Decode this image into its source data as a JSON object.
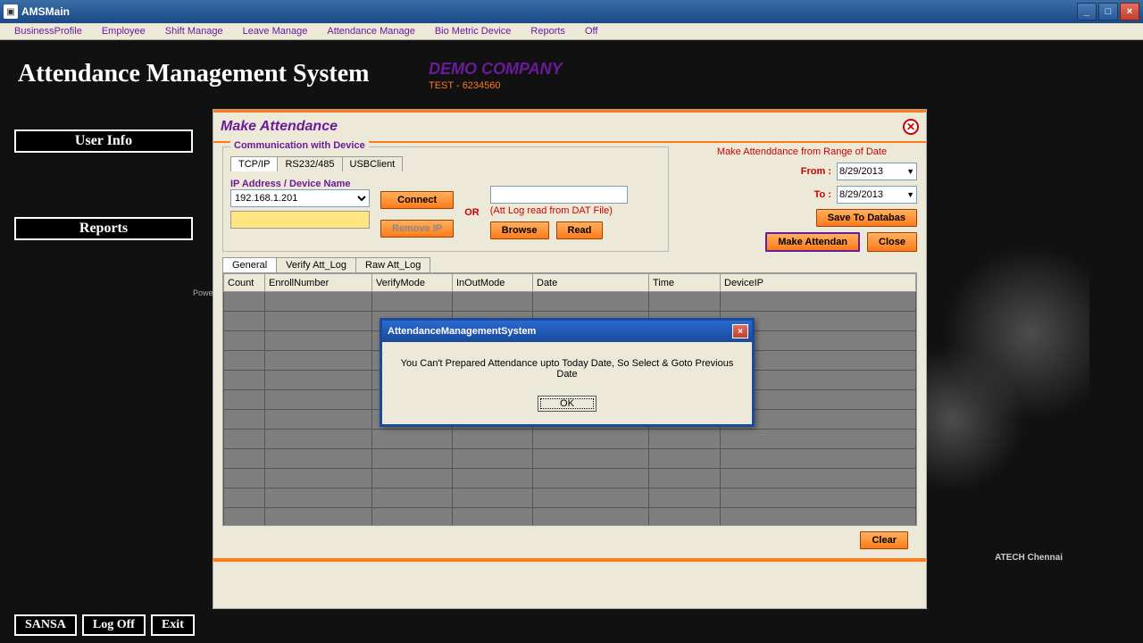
{
  "window": {
    "title": "AMSMain"
  },
  "menubar": [
    "BusinessProfile",
    "Employee",
    "Shift Manage",
    "Leave Manage",
    "Attendance Manage",
    "Bio Metric Device",
    "Reports",
    "Off"
  ],
  "app_title": "Attendance Management System",
  "company": {
    "name": "DEMO COMPANY",
    "sub": "TEST - 6234560"
  },
  "sidebar": {
    "userinfo": "User Info",
    "reports": "Reports"
  },
  "bottom": {
    "sansa": "SANSA",
    "logoff": "Log Off",
    "exit": "Exit"
  },
  "powered": "Powered",
  "chennai": "ATECH Chennai",
  "make_att": {
    "title": "Make Attendance",
    "comm_legend": "Communication with Device",
    "proto_tabs": [
      "TCP/IP",
      "RS232/485",
      "USBClient"
    ],
    "ip_label": "IP Address / Device Name",
    "ip_value": "192.168.1.201",
    "connect": "Connect",
    "remove_ip": "Remove IP",
    "or": "OR",
    "dat_label": "(Att Log read from DAT File)",
    "browse": "Browse",
    "read": "Read",
    "range_title": "Make Attenddance from Range of Date",
    "from_label": "From :",
    "to_label": "To :",
    "from_date": "8/29/2013",
    "to_date": "8/29/2013",
    "save_db": "Save To Databas",
    "make_att_btn": "Make Attendan",
    "close": "Close",
    "att_tabs": [
      "General",
      "Verify Att_Log",
      "Raw Att_Log"
    ],
    "columns": [
      "Count",
      "EnrollNumber",
      "VerifyMode",
      "InOutMode",
      "Date",
      "Time",
      "DeviceIP"
    ],
    "clear": "Clear"
  },
  "modal": {
    "title": "AttendanceManagementSystem",
    "message": "You Can't Prepared Attendance upto Today Date, So Select & Goto Previous Date",
    "ok": "OK"
  }
}
